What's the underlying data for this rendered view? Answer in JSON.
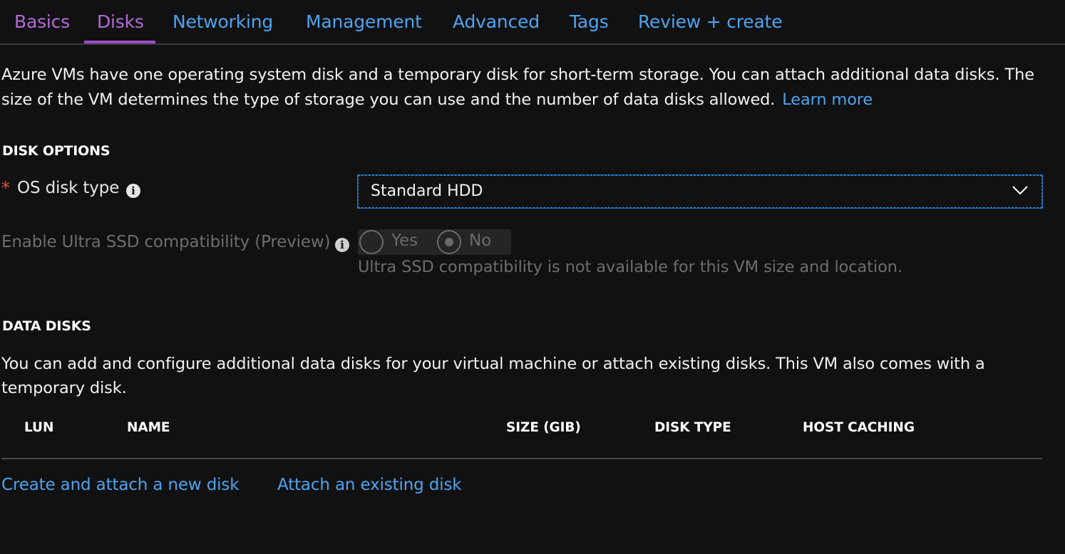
{
  "tabs": [
    {
      "label": "Basics"
    },
    {
      "label": "Disks"
    },
    {
      "label": "Networking"
    },
    {
      "label": "Management"
    },
    {
      "label": "Advanced"
    },
    {
      "label": "Tags"
    },
    {
      "label": "Review + create"
    }
  ],
  "intro": {
    "text": "Azure VMs have one operating system disk and a temporary disk for short-term storage. You can attach additional data disks. The size of the VM determines the type of storage you can use and the number of data disks allowed.",
    "learn_more": "Learn more"
  },
  "disk_options": {
    "heading": "DISK OPTIONS",
    "required_marker": "*",
    "os_disk_type_label": "OS disk type",
    "os_disk_type_value": "Standard HDD",
    "ultra_ssd_label": "Enable Ultra SSD compatibility (Preview)",
    "ultra_ssd_yes": "Yes",
    "ultra_ssd_no": "No",
    "ultra_ssd_selected": "No",
    "ultra_ssd_helper": "Ultra SSD compatibility is not available for this VM size and location."
  },
  "data_disks": {
    "heading": "DATA DISKS",
    "description": "You can add and configure additional data disks for your virtual machine or attach existing disks. This VM also comes with a temporary disk.",
    "columns": [
      "LUN",
      "NAME",
      "SIZE (GIB)",
      "DISK TYPE",
      "HOST CACHING"
    ],
    "create_link": "Create and attach a new disk",
    "attach_link": "Attach an existing disk"
  },
  "colors": {
    "background": "#111111",
    "link": "#4ea3f0",
    "active_tab": "#b36ad8",
    "required": "#e74c3c"
  }
}
